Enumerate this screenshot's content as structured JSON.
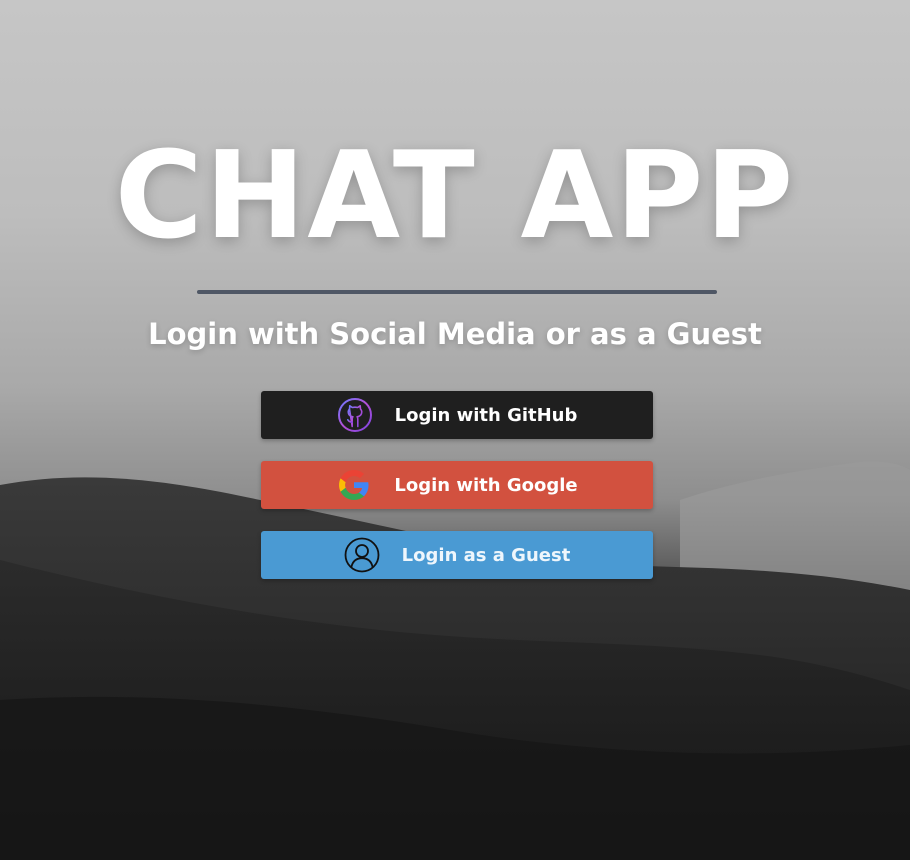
{
  "app": {
    "title": "CHAT APP",
    "subtitle": "Login with Social Media or as a Guest"
  },
  "buttons": [
    {
      "id": "github",
      "label": "Login with GitHub",
      "icon": "github-icon",
      "color": "#1f1f1f"
    },
    {
      "id": "google",
      "label": "Login with Google",
      "icon": "google-icon",
      "color": "#d2513f"
    },
    {
      "id": "guest",
      "label": "Login as a Guest",
      "icon": "user-icon",
      "color": "#4a9ad3"
    }
  ],
  "colors": {
    "divider": "#4f5765",
    "text": "#ffffff"
  }
}
